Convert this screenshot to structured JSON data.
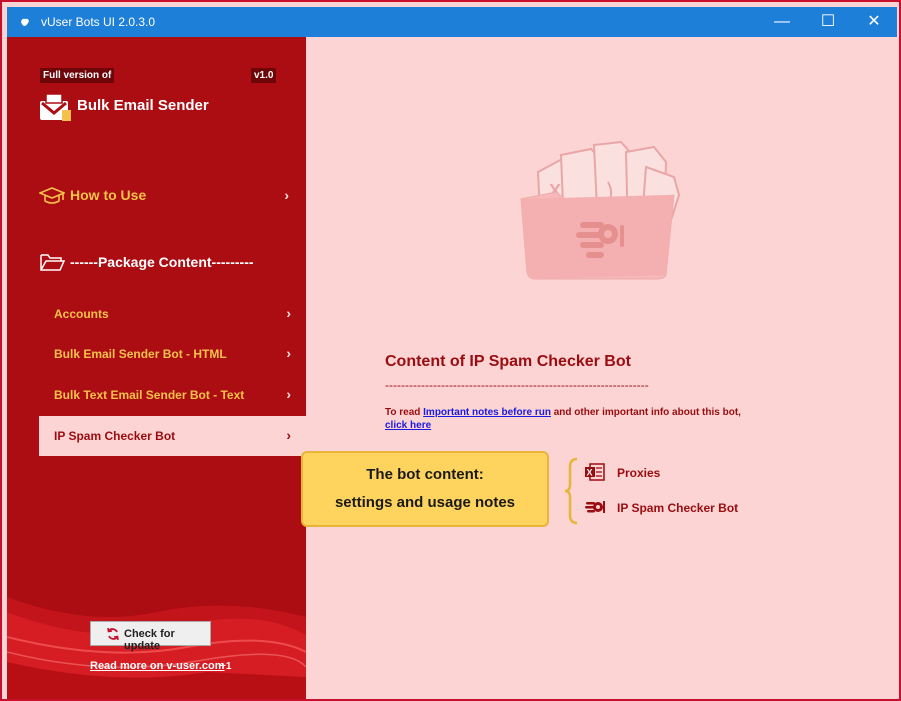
{
  "window": {
    "title": "vUser Bots UI 2.0.3.0",
    "controls": {
      "minimize": "—",
      "maximize": "☐",
      "close": "✕"
    }
  },
  "sidebar": {
    "full_version_label": "Full version of",
    "version": "v1.0",
    "app_name": "Bulk Email Sender",
    "how_to_use": "How to Use",
    "package_content": "------Package Content---------",
    "items": [
      {
        "label": "Accounts"
      },
      {
        "label": "Bulk Email Sender Bot - HTML"
      },
      {
        "label": "Bulk Text Email Sender Bot - Text"
      },
      {
        "label": "IP Spam Checker Bot"
      }
    ],
    "active_item": "IP Spam Checker Bot",
    "check_update": "Check for update",
    "read_more": "Read more on v-user.com",
    "read_more_badge": "+1"
  },
  "main": {
    "content_title": "Content of IP Spam Checker Bot",
    "rule": "------------------------------------------------------------------",
    "notes_prefix": "To read ",
    "notes_link": "Important notes before run",
    "notes_middle": " and other important info about this bot, ",
    "notes_link2": "click here",
    "callout_line1": "The bot content:",
    "callout_line2": "settings and usage notes",
    "list": [
      {
        "label": "Proxies",
        "icon": "excel-icon"
      },
      {
        "label": "IP Spam Checker Bot",
        "icon": "robot-hand-icon"
      }
    ]
  },
  "colors": {
    "sidebar_bg": "#ab0d13",
    "content_bg": "#fcd4d4",
    "accent_gold": "#f4c24a",
    "titlebar_blue": "#1e7fd8",
    "callout_yellow": "#ffd45e"
  }
}
